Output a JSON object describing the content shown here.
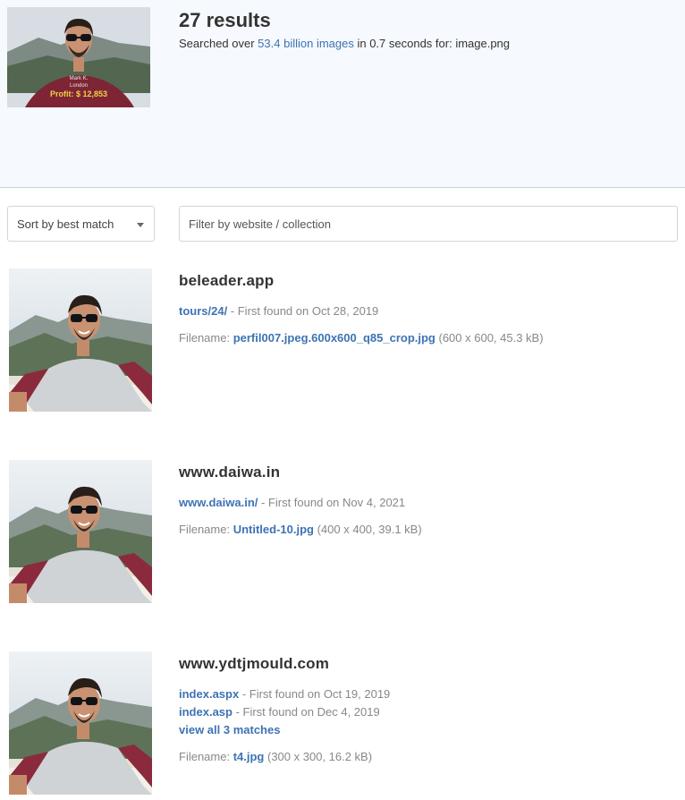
{
  "query": {
    "overlay_name": "Mark K.",
    "overlay_city": "London",
    "overlay_profit": "Profit: $ 12,853"
  },
  "header": {
    "title": "27 results",
    "searched_prefix": "Searched over ",
    "index_size": "53.4 billion images",
    "searched_mid": " in 0.7 seconds for: ",
    "query_file": "image.png"
  },
  "controls": {
    "sort_label": "Sort by best match",
    "filter_placeholder": "Filter by website / collection"
  },
  "results": [
    {
      "domain": "beleader.app",
      "pages": [
        {
          "path": "tours/24/",
          "found": " - First found on Oct 28, 2019"
        }
      ],
      "view_all": "",
      "filename_label": "Filename: ",
      "filename": "perfil007.jpeg.600x600_q85_crop.jpg",
      "file_meta": " (600 x 600, 45.3 kB)"
    },
    {
      "domain": "www.daiwa.in",
      "pages": [
        {
          "path": "www.daiwa.in/",
          "found": " - First found on Nov 4, 2021"
        }
      ],
      "view_all": "",
      "filename_label": "Filename: ",
      "filename": "Untitled-10.jpg",
      "file_meta": " (400 x 400, 39.1 kB)"
    },
    {
      "domain": "www.ydtjmould.com",
      "pages": [
        {
          "path": "index.aspx",
          "found": " - First found on Oct 19, 2019"
        },
        {
          "path": "index.asp",
          "found": " - First found on Dec 4, 2019"
        }
      ],
      "view_all": "view all 3 matches",
      "filename_label": "Filename: ",
      "filename": "t4.jpg",
      "file_meta": " (300 x 300, 16.2 kB)"
    }
  ]
}
